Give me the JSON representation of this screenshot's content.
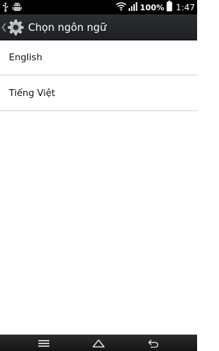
{
  "status_bar": {
    "battery": "100%",
    "time": "1:47",
    "icons": [
      "usb-icon",
      "android-debug-icon",
      "wifi-icon",
      "signal-icon",
      "battery-icon"
    ]
  },
  "action_bar": {
    "title": "Chọn ngôn ngữ",
    "icons": [
      "back-chevron-icon",
      "settings-gear-icon"
    ]
  },
  "languages": {
    "items": [
      {
        "label": "English"
      },
      {
        "label": "Tiếng Việt"
      }
    ]
  },
  "nav_bar": {
    "icons": [
      "menu-icon",
      "home-icon",
      "back-icon"
    ]
  },
  "colors": {
    "status_bar": "#000000",
    "action_bar": "#26292c",
    "list_bg": "#ffffff",
    "divider": "#cfcfcf",
    "nav_bar": "#1c1c1c"
  }
}
